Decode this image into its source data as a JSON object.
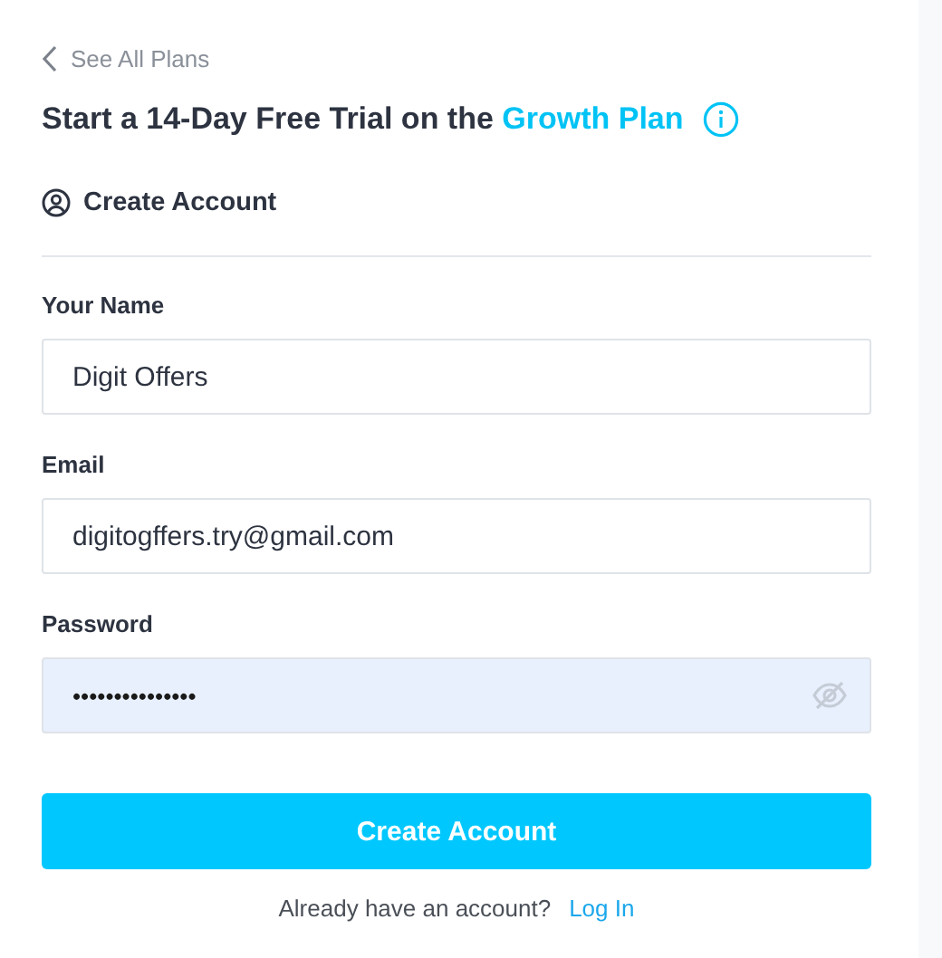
{
  "back_link": "See All Plans",
  "heading": {
    "text": "Start a 14-Day Free Trial on the ",
    "link": "Growth Plan"
  },
  "section_title": "Create Account",
  "fields": [
    {
      "kind": "text",
      "label": "Your Name",
      "value": "Digit Offers"
    },
    {
      "kind": "text",
      "label": "Email",
      "value": "digitogffers.try@gmail.com"
    },
    {
      "kind": "password",
      "label": "Password",
      "value": "•••••••••••••••"
    }
  ],
  "submit_button": "Create Account",
  "footer": {
    "text": "Already have an account?",
    "link": "Log In"
  }
}
